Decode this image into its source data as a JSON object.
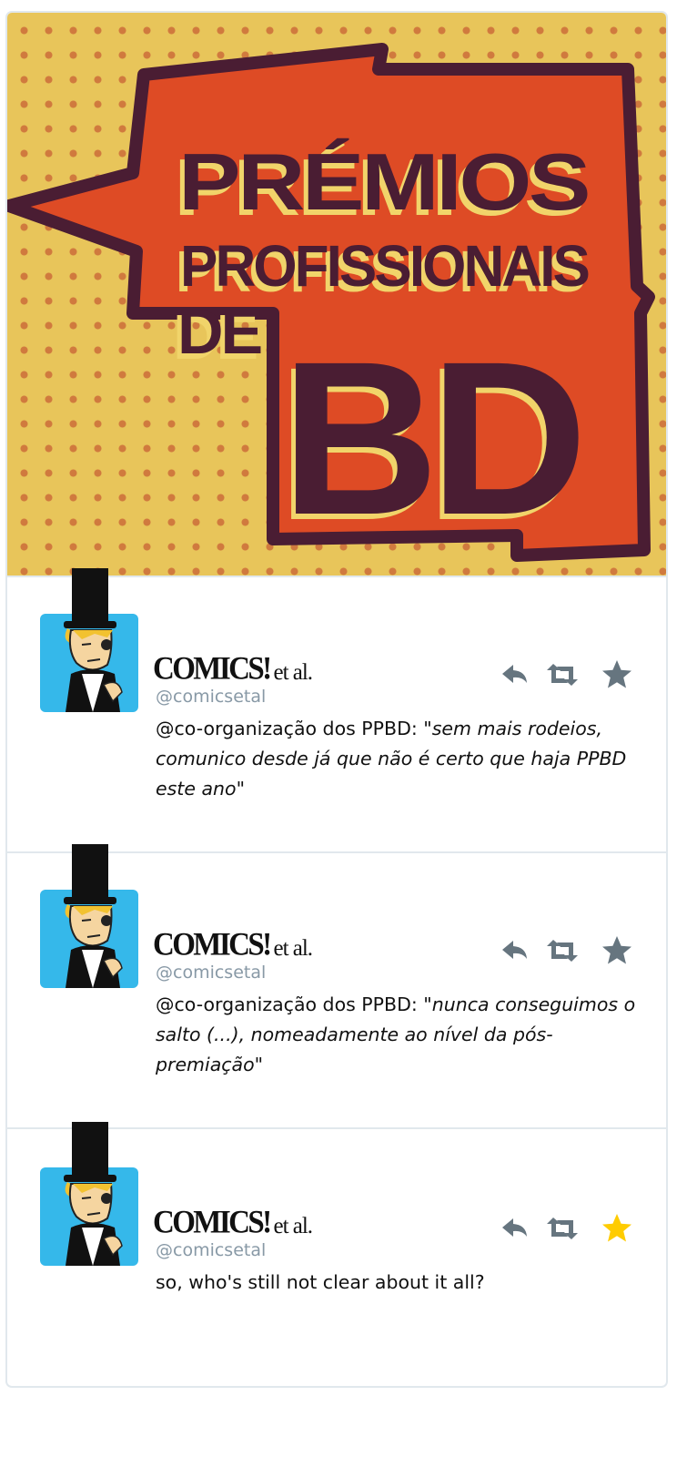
{
  "banner": {
    "title_line1": "PRÉMIOS",
    "title_line2": "PROFISSIONAIS",
    "title_line3": "DE",
    "title_line4": "BD",
    "colors": {
      "background": "#e8c55a",
      "dots": "#d07a3e",
      "bubble": "#de4b25",
      "ink": "#4a1d33",
      "shadow": "#f1d46a"
    }
  },
  "tweets": [
    {
      "brand_main": "COMICS!",
      "brand_suffix": "et al.",
      "handle": "@comicsetal",
      "text_prefix": "@co-organização dos PPBD: \"",
      "text_quote": "sem mais rodeios, comunico desde já que não é certo que haja PPBD este ano",
      "text_suffix": "\"",
      "favorited": false
    },
    {
      "brand_main": "COMICS!",
      "brand_suffix": "et al.",
      "handle": "@comicsetal",
      "text_prefix": "@co-organização dos PPBD: \"",
      "text_quote": "nunca conseguimos o salto (...), nomeadamente ao nível da pós-premiação",
      "text_suffix": "\"",
      "favorited": false
    },
    {
      "brand_main": "COMICS!",
      "brand_suffix": "et al.",
      "handle": "@comicsetal",
      "text_prefix": "so, who's still not clear about it all?",
      "text_quote": "",
      "text_suffix": "",
      "favorited": true
    }
  ],
  "icons": {
    "reply": "reply-icon",
    "retweet": "retweet-icon",
    "favorite": "star-icon"
  },
  "colors": {
    "action_gray": "#66757f",
    "favorite_active": "#ffcc00",
    "avatar_bg": "#35b8ea",
    "handle": "#8899a6"
  }
}
